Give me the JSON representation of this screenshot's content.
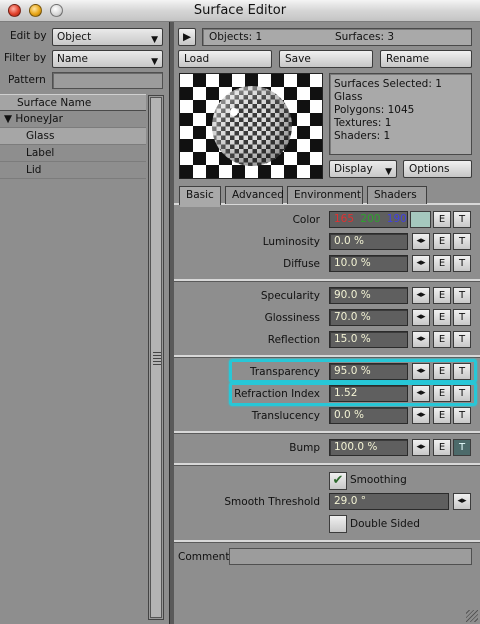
{
  "window": {
    "title": "Surface Editor"
  },
  "left": {
    "edit_by_label": "Edit by",
    "edit_by_value": "Object",
    "filter_by_label": "Filter by",
    "filter_by_value": "Name",
    "pattern_label": "Pattern",
    "pattern_value": "",
    "list_header": "Surface Name",
    "tree": {
      "group": "HoneyJar",
      "items": [
        "Glass",
        "Label",
        "Lid"
      ],
      "selected": "Glass"
    }
  },
  "top": {
    "objects_text": "Objects: 1",
    "surfaces_text": "Surfaces: 3",
    "load_label": "Load",
    "save_label": "Save",
    "rename_label": "Rename"
  },
  "stats": {
    "selected": "Surfaces Selected: 1",
    "name": "Glass",
    "polygons": "Polygons: 1045",
    "textures": "Textures: 1",
    "shaders": "Shaders: 1"
  },
  "preview_controls": {
    "display_label": "Display",
    "options_label": "Options"
  },
  "tabs": [
    "Basic",
    "Advanced",
    "Environment",
    "Shaders"
  ],
  "active_tab": "Basic",
  "basic": {
    "color": {
      "label": "Color",
      "r": "165",
      "g": "200",
      "b": "190",
      "r_color": "#d01c1c",
      "g_color": "#2a8f2a",
      "b_color": "#2b2bd0",
      "swatch": "#a5c8be"
    },
    "luminosity": {
      "label": "Luminosity",
      "value": "0.0 %"
    },
    "diffuse": {
      "label": "Diffuse",
      "value": "10.0 %"
    },
    "specularity": {
      "label": "Specularity",
      "value": "90.0 %"
    },
    "glossiness": {
      "label": "Glossiness",
      "value": "70.0 %"
    },
    "reflection": {
      "label": "Reflection",
      "value": "15.0 %"
    },
    "transparency": {
      "label": "Transparency",
      "value": "95.0 %"
    },
    "refraction": {
      "label": "Refraction Index",
      "value": "1.52"
    },
    "translucency": {
      "label": "Translucency",
      "value": "0.0 %"
    },
    "bump": {
      "label": "Bump",
      "value": "100.0 %"
    },
    "smoothing": {
      "label": "Smoothing",
      "checked": true
    },
    "smooth_threshold": {
      "label": "Smooth Threshold",
      "value": "29.0 °"
    },
    "double_sided": {
      "label": "Double Sided",
      "checked": false
    },
    "comment": {
      "label": "Comment",
      "value": ""
    }
  },
  "buttons": {
    "env": "◂▸",
    "e": "E",
    "t": "T",
    "play": "▶"
  },
  "highlight_color": "#27c7d7"
}
